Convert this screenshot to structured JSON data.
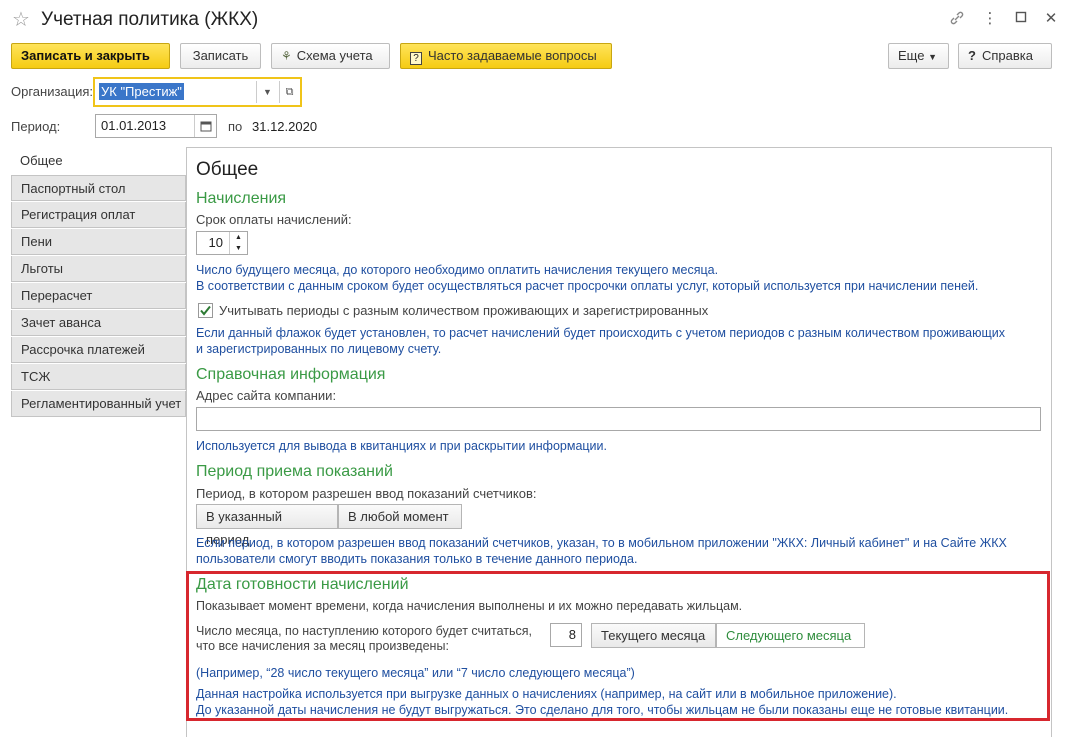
{
  "window": {
    "title": "Учетная политика (ЖКХ)",
    "controls": [
      "link-icon",
      "more-icon",
      "maximize-icon",
      "close-icon"
    ]
  },
  "toolbar": {
    "save_close": "Записать и закрыть",
    "save": "Записать",
    "schema": "Схема учета",
    "faq": "Часто задаваемые вопросы",
    "more": "Еще",
    "help": "Справка"
  },
  "form": {
    "org_label": "Организация:",
    "org_value": "УК \"Престиж\"",
    "period_label": "Период:",
    "period_from": "01.01.2013",
    "period_to_label": "по",
    "period_to": "31.12.2020"
  },
  "tabs": [
    {
      "label": "Общее",
      "active": true
    },
    {
      "label": "Паспортный стол"
    },
    {
      "label": "Регистрация оплат"
    },
    {
      "label": "Пени"
    },
    {
      "label": "Льготы"
    },
    {
      "label": "Перерасчет"
    },
    {
      "label": "Зачет аванса"
    },
    {
      "label": "Рассрочка платежей"
    },
    {
      "label": "ТСЖ"
    },
    {
      "label": "Регламентированный учет"
    }
  ],
  "main": {
    "heading": "Общее",
    "charges": {
      "title": "Начисления",
      "term_label": "Срок оплаты начислений:",
      "term_value": "10",
      "hint1": "Число будущего месяца, до которого необходимо оплатить начисления текущего месяца.",
      "hint2": "В соответствии с данным сроком будет осуществляться расчет просрочки оплаты услуг, который используется при начислении пеней.",
      "checkbox_label": "Учитывать периоды с разным количеством проживающих и зарегистрированных",
      "checkbox_checked": true,
      "checkbox_hint1": "Если данный флажок будет установлен, то расчет начислений будет происходить с учетом периодов с разным количеством проживающих",
      "checkbox_hint2": "и зарегистрированных по лицевому счету."
    },
    "reference": {
      "title": "Справочная информация",
      "site_label": "Адрес сайта компании:",
      "site_value": "",
      "hint": "Используется для вывода в квитанциях и при раскрытии информации."
    },
    "readings": {
      "title": "Период приема показаний",
      "label": "Период, в котором разрешен ввод показаний счетчиков:",
      "opt1": "В указанный период",
      "opt2": "В любой момент",
      "hint1": "Если период, в котором разрешен ввод показаний счетчиков, указан, то в мобильном приложении \"ЖКХ: Личный кабинет\" и на Сайте ЖКХ",
      "hint2": "пользователи смогут вводить показания только в течение данного периода."
    },
    "ready_date": {
      "title": "Дата готовности начислений",
      "desc": "Показывает момент времени, когда начисления выполнены и их можно передавать жильцам.",
      "day_label1": "Число месяца, по наступлению которого будет считаться,",
      "day_label2": "что все начисления за месяц произведены:",
      "day_value": "8",
      "opt_current": "Текущего месяца",
      "opt_next": "Следующего месяца",
      "example": "(Например, “28 число текущего месяца” или “7 число следующего месяца”)",
      "hint1": "Данная настройка используется при выгрузке данных о начислениях (например, на сайт или в мобильное приложение).",
      "hint2": "До указанной даты начисления не будут выгружаться. Это сделано для того, чтобы жильцам не были показаны еще не готовые квитанции."
    }
  },
  "colors": {
    "accent_yellow": "#f5cc13",
    "section_green": "#3a9a45",
    "hint_blue": "#1f4fa0",
    "highlight_red": "#d7272e"
  }
}
